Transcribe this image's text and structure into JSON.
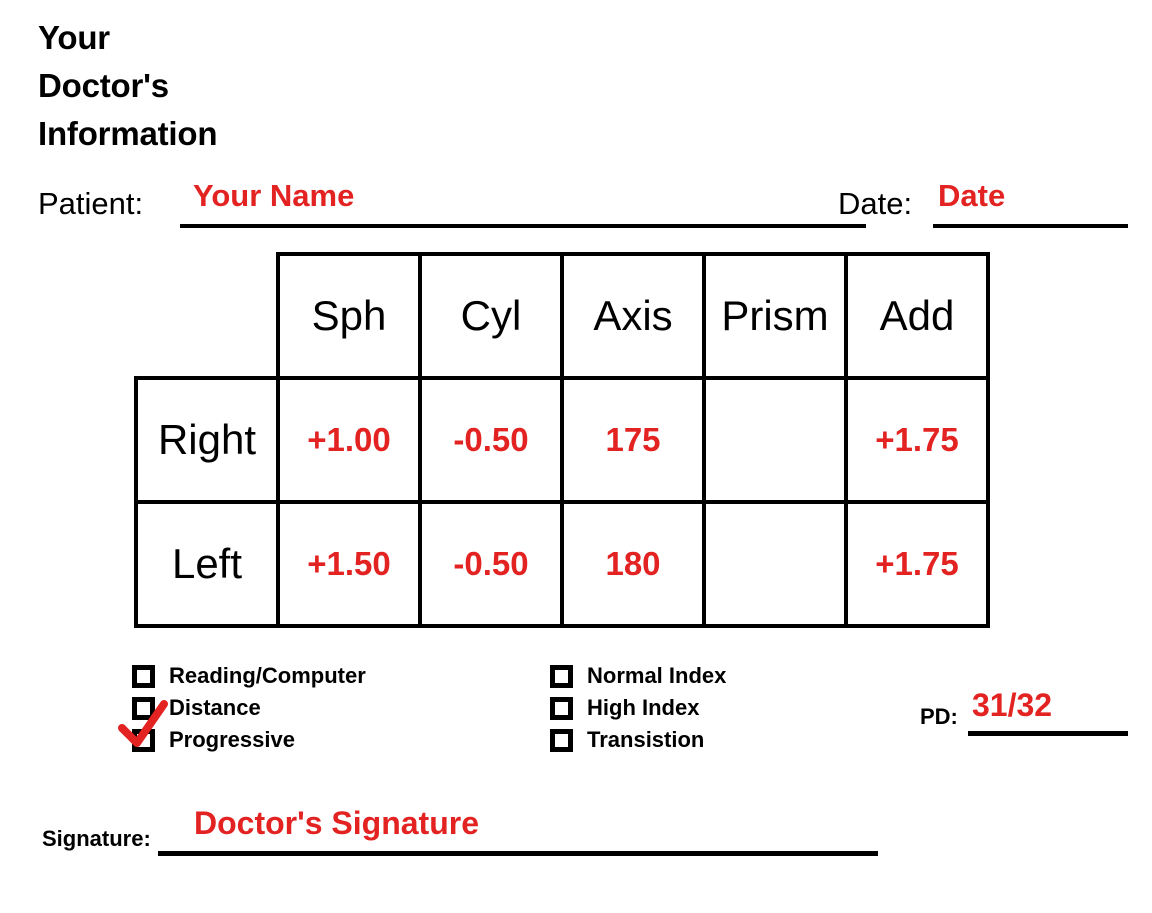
{
  "header": {
    "lines": [
      "Your",
      "Doctor's",
      "Information"
    ]
  },
  "patient": {
    "label": "Patient:",
    "value": "Your Name"
  },
  "date": {
    "label": "Date:",
    "value": "Date"
  },
  "prescription_table": {
    "columns": [
      "Sph",
      "Cyl",
      "Axis",
      "Prism",
      "Add"
    ],
    "rows": [
      {
        "eye": "Right",
        "sph": "+1.00",
        "cyl": "-0.50",
        "axis": "175",
        "prism": "",
        "add": "+1.75"
      },
      {
        "eye": "Left",
        "sph": "+1.50",
        "cyl": "-0.50",
        "axis": "180",
        "prism": "",
        "add": "+1.75"
      }
    ]
  },
  "options": {
    "lens_type": [
      {
        "label": "Reading/Computer",
        "checked": false
      },
      {
        "label": "Distance",
        "checked": false
      },
      {
        "label": "Progressive",
        "checked": true
      }
    ],
    "lens_index": [
      {
        "label": "Normal Index",
        "checked": false
      },
      {
        "label": "High Index",
        "checked": false
      },
      {
        "label": "Transistion",
        "checked": false
      }
    ]
  },
  "pd": {
    "label": "PD:",
    "value": "31/32"
  },
  "signature": {
    "label": "Signature:",
    "value": "Doctor's Signature"
  },
  "colors": {
    "ink_red": "#e32222",
    "ink_black": "#000000",
    "paper": "#ffffff"
  }
}
